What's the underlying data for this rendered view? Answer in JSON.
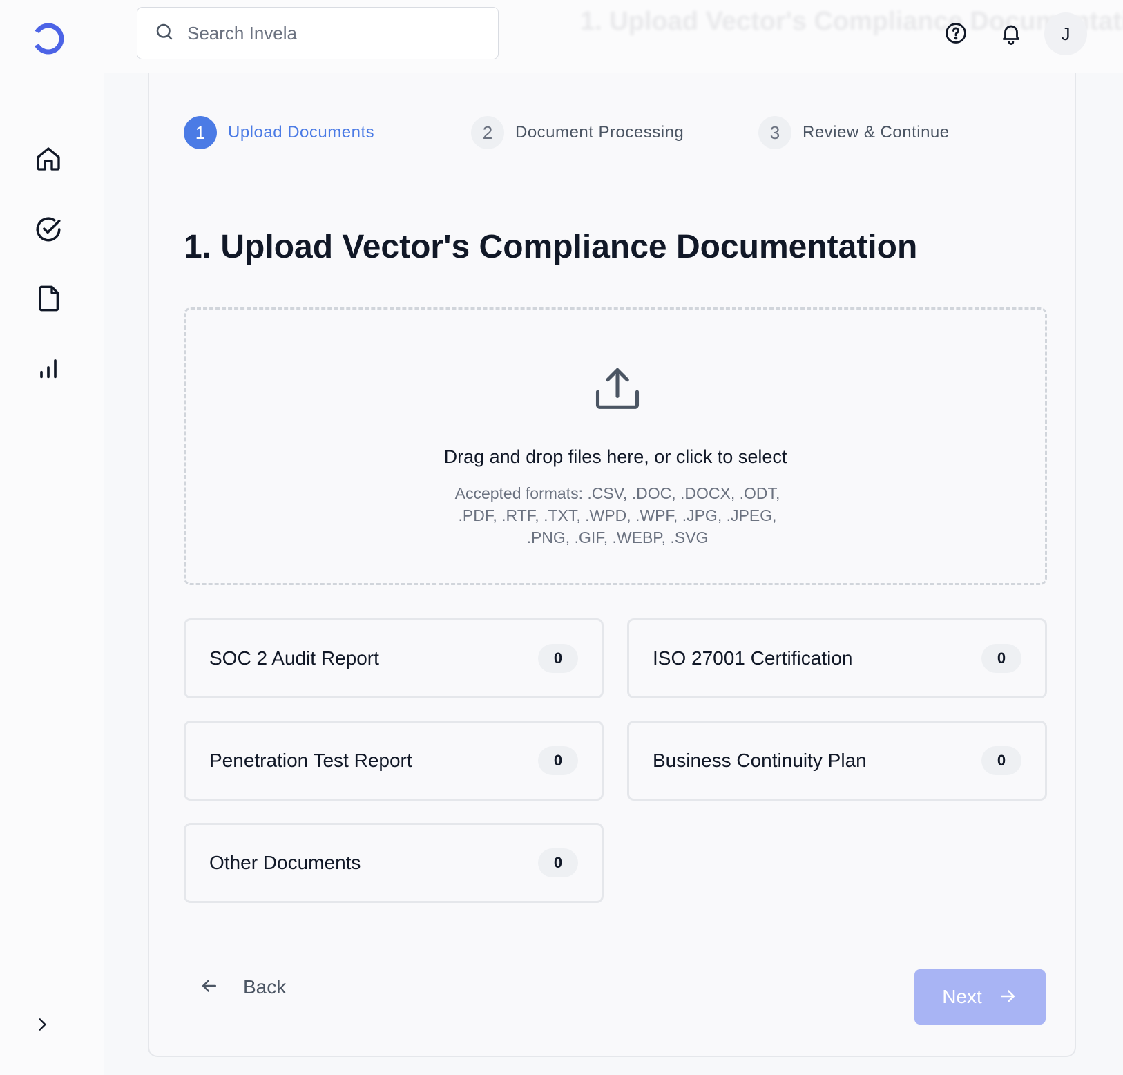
{
  "colors": {
    "accent": "#4b7be5",
    "next_button_disabled": "#a8b4f4",
    "logo": "#4c63e6"
  },
  "sidebar": {
    "logo_icon": "invela-logo-icon",
    "items": [
      {
        "icon": "home-icon"
      },
      {
        "icon": "check-circle-icon"
      },
      {
        "icon": "file-icon"
      },
      {
        "icon": "bar-chart-icon"
      }
    ],
    "expand_icon": "chevron-right-icon"
  },
  "header": {
    "search_placeholder": "Search Invela",
    "help_icon": "help-circle-icon",
    "notification_icon": "bell-icon",
    "avatar_initial": "J"
  },
  "stepper": {
    "steps": [
      {
        "number": "1",
        "label": "Upload Documents",
        "active": true
      },
      {
        "number": "2",
        "label": "Document Processing",
        "active": false
      },
      {
        "number": "3",
        "label": "Review & Continue",
        "active": false
      }
    ]
  },
  "main": {
    "title": "1. Upload Vector's Compliance Documentation",
    "dropzone": {
      "icon": "upload-icon",
      "instruction": "Drag and drop files here, or click to select",
      "formats": "Accepted formats: .CSV, .DOC, .DOCX, .ODT, .PDF, .RTF, .TXT, .WPD, .WPF, .JPG, .JPEG, .PNG, .GIF, .WEBP, .SVG"
    },
    "categories": [
      {
        "name": "SOC 2 Audit Report",
        "count": "0"
      },
      {
        "name": "ISO 27001 Certification",
        "count": "0"
      },
      {
        "name": "Penetration Test Report",
        "count": "0"
      },
      {
        "name": "Business Continuity Plan",
        "count": "0"
      },
      {
        "name": "Other Documents",
        "count": "0"
      }
    ]
  },
  "footer": {
    "back_label": "Back",
    "next_label": "Next",
    "next_enabled": false
  }
}
